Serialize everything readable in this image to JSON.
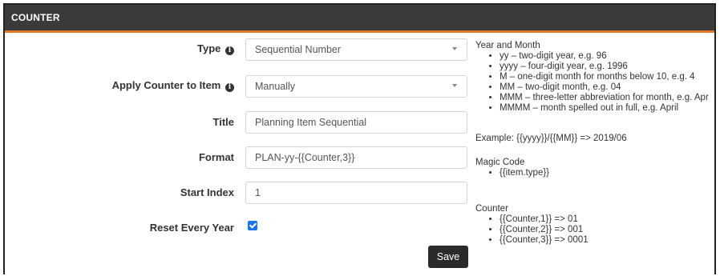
{
  "header": {
    "title": "COUNTER"
  },
  "form": {
    "type_label": "Type",
    "type_value": "Sequential Number",
    "apply_label": "Apply Counter to Item",
    "apply_value": "Manually",
    "title_label": "Title",
    "title_placeholder": "Planning Item Sequential",
    "format_label": "Format",
    "format_placeholder": "PLAN-yy-{{Counter,3}}",
    "start_index_label": "Start Index",
    "start_index_placeholder": "1",
    "reset_label": "Reset Every Year",
    "reset_checked": true,
    "save_label": "Save"
  },
  "help": {
    "year_month_heading": "Year and Month",
    "year_month_items": [
      "yy – two-digit year, e.g. 96",
      "yyyy – four-digit year, e.g. 1996",
      "M – one-digit month for months below 10, e.g. 4",
      "MM – two-digit month, e.g. 04",
      "MMM – three-letter abbreviation for month, e.g. Apr",
      "MMMM – month spelled out in full, e.g. April"
    ],
    "example": "Example: {{yyyy}}/{{MM}} => 2019/06",
    "magic_heading": "Magic Code",
    "magic_items": [
      "{{item.type}}"
    ],
    "counter_heading": "Counter",
    "counter_items": [
      "{{Counter,1}} => 01",
      "{{Counter,2}} => 001",
      "{{Counter,3}} => 0001"
    ]
  }
}
